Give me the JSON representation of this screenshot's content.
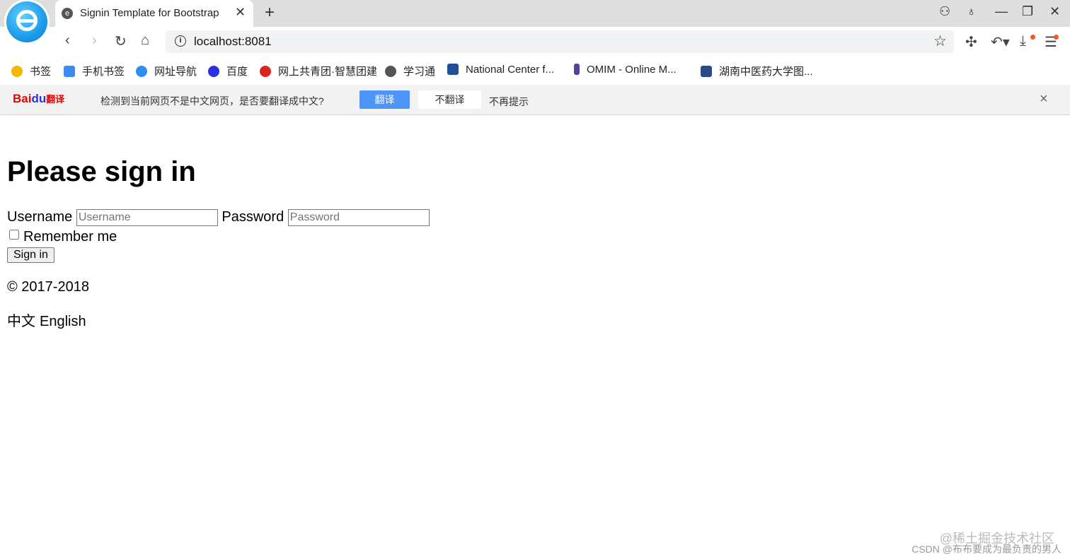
{
  "browser": {
    "tab_title": "Signin Template for Bootstrap",
    "address": "localhost:8081",
    "bookmarks": [
      {
        "label": "书签",
        "color": "#f5b800"
      },
      {
        "label": "手机书签",
        "color": "#3b8cf0"
      },
      {
        "label": "网址导航",
        "color": "#2b8ef0"
      },
      {
        "label": "百度",
        "color": "#2932e1"
      },
      {
        "label": "网上共青团·智慧团建",
        "color": "#d8261c"
      },
      {
        "label": "学习通",
        "color": "#555555"
      },
      {
        "label": "National Center f...",
        "color": "#1f4f99"
      },
      {
        "label": "OMIM - Online M...",
        "color": "#5b3fa0"
      },
      {
        "label": "湖南中医药大学图...",
        "color": "#2a4a8a"
      }
    ]
  },
  "translate_bar": {
    "logo_bai": "Bai",
    "logo_du": "du",
    "logo_suffix": "翻译",
    "message": "检测到当前网页不是中文网页，是否要翻译成中文?",
    "translate_label": "翻译",
    "no_translate_label": "不翻译",
    "never_label": "不再提示",
    "close": "×"
  },
  "page": {
    "heading": "Please sign in",
    "username_label": "Username",
    "username_placeholder": "Username",
    "password_label": "Password",
    "password_placeholder": "Password",
    "remember_label": "Remember me",
    "remember_checked": false,
    "signin_label": "Sign in",
    "copyright": "© 2017-2018",
    "lang_zh": "中文",
    "lang_en": "English"
  },
  "watermark": {
    "line1": "@稀土掘金技术社区",
    "line2": "CSDN @布布要成为最负责的男人"
  }
}
